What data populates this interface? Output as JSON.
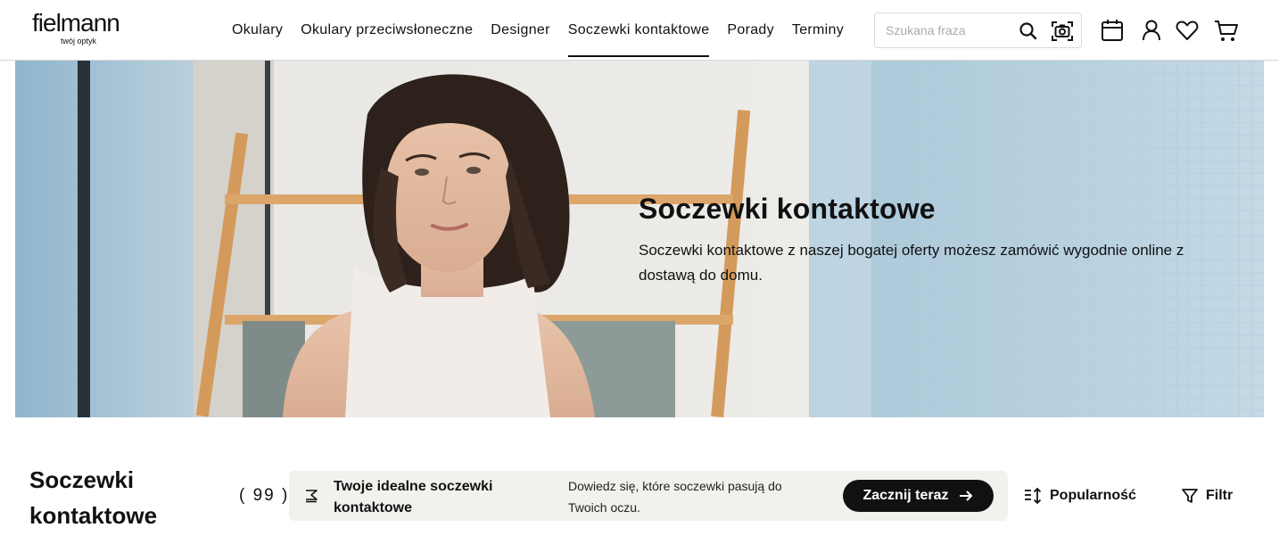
{
  "header": {
    "logo_text": "fielmann",
    "logo_tagline": "twój optyk",
    "nav": [
      {
        "label": "Okulary"
      },
      {
        "label": "Okulary przeciwsłoneczne"
      },
      {
        "label": "Designer"
      },
      {
        "label": "Soczewki kontaktowe",
        "active": true
      },
      {
        "label": "Porady"
      },
      {
        "label": "Terminy"
      }
    ],
    "search": {
      "placeholder": "Szukana fraza",
      "value": ""
    },
    "icons": [
      "search-icon",
      "camera-search-icon",
      "calendar-icon",
      "user-icon",
      "heart-icon",
      "cart-icon"
    ]
  },
  "hero": {
    "title": "Soczewki kontaktowe",
    "text": "Soczewki kontaktowe z naszej bogatej oferty możesz zamówić wygodnie online z dostawą do domu."
  },
  "listing": {
    "title": "Soczewki kontaktowe",
    "count": "( 99 )",
    "promo": {
      "title": "Twoje idealne soczewki kontaktowe",
      "description": "Dowiedz się, które soczewki pasują do Twoich oczu.",
      "button_label": "Zacznij teraz"
    },
    "sort_label": "Popularność",
    "filter_label": "Filtr"
  },
  "colors": {
    "text": "#111111",
    "promo_bg": "#f2f1ee",
    "button_bg": "#111111",
    "header_border": "#d6d6d6"
  }
}
